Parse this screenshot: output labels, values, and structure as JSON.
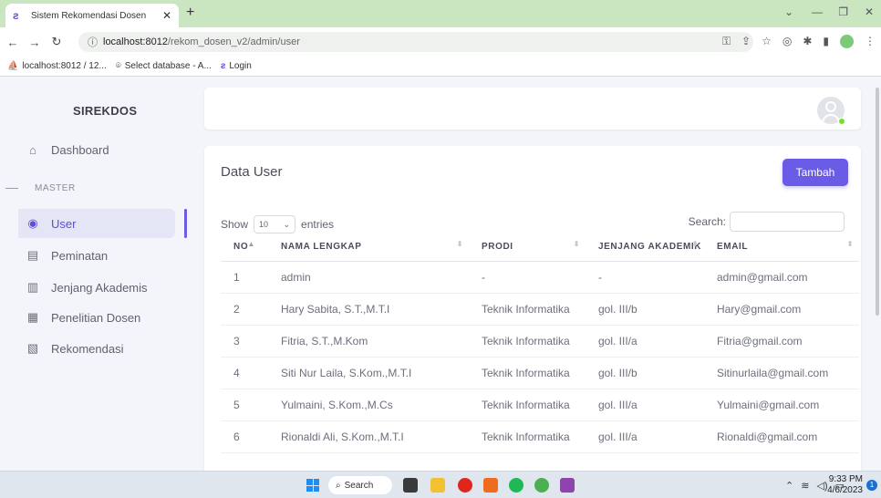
{
  "browser": {
    "tab_title": "Sistem Rekomendasi Dosen",
    "url_host": "localhost:8012",
    "url_path": "/rekom_dosen_v2/admin/user",
    "bookmarks": [
      "localhost:8012 / 12...",
      "Select database - A...",
      "Login"
    ]
  },
  "sidebar": {
    "brand": "SIREKDOS",
    "dashboard": "Dashboard",
    "section": "MASTER",
    "items": [
      {
        "label": "User",
        "icon": "user-circle-icon"
      },
      {
        "label": "Peminatan",
        "icon": "clipboard-icon"
      },
      {
        "label": "Jenjang Akademis",
        "icon": "book-icon"
      },
      {
        "label": "Penelitian Dosen",
        "icon": "columns-icon"
      },
      {
        "label": "Rekomendasi",
        "icon": "file-icon"
      }
    ],
    "active_color": "#6b5ce7"
  },
  "card": {
    "title": "Data User",
    "add_button": "Tambah",
    "show_label": "Show",
    "entries_value": "10",
    "entries_label": "entries",
    "search_label": "Search:"
  },
  "table": {
    "columns": [
      "NO",
      "NAMA LENGKAP",
      "PRODI",
      "JENJANG AKADEMIK",
      "EMAIL"
    ],
    "rows": [
      [
        "1",
        "admin",
        "-",
        "-",
        "admin@gmail.com"
      ],
      [
        "2",
        "Hary Sabita, S.T.,M.T.I",
        "Teknik Informatika",
        "gol. III/b",
        "Hary@gmail.com"
      ],
      [
        "3",
        "Fitria, S.T.,M.Kom",
        "Teknik Informatika",
        "gol. III/a",
        "Fitria@gmail.com"
      ],
      [
        "4",
        "Siti Nur Laila, S.Kom.,M.T.I",
        "Teknik Informatika",
        "gol. III/b",
        "Sitinurlaila@gmail.com"
      ],
      [
        "5",
        "Yulmaini, S.Kom.,M.Cs",
        "Teknik Informatika",
        "gol. III/a",
        "Yulmaini@gmail.com"
      ],
      [
        "6",
        "Rionaldi Ali, S.Kom.,M.T.I",
        "Teknik Informatika",
        "gol. III/a",
        "Rionaldi@gmail.com"
      ]
    ]
  },
  "taskbar": {
    "search": "Search",
    "time": "9:33 PM",
    "date": "4/6/2023",
    "notifications": "1"
  }
}
